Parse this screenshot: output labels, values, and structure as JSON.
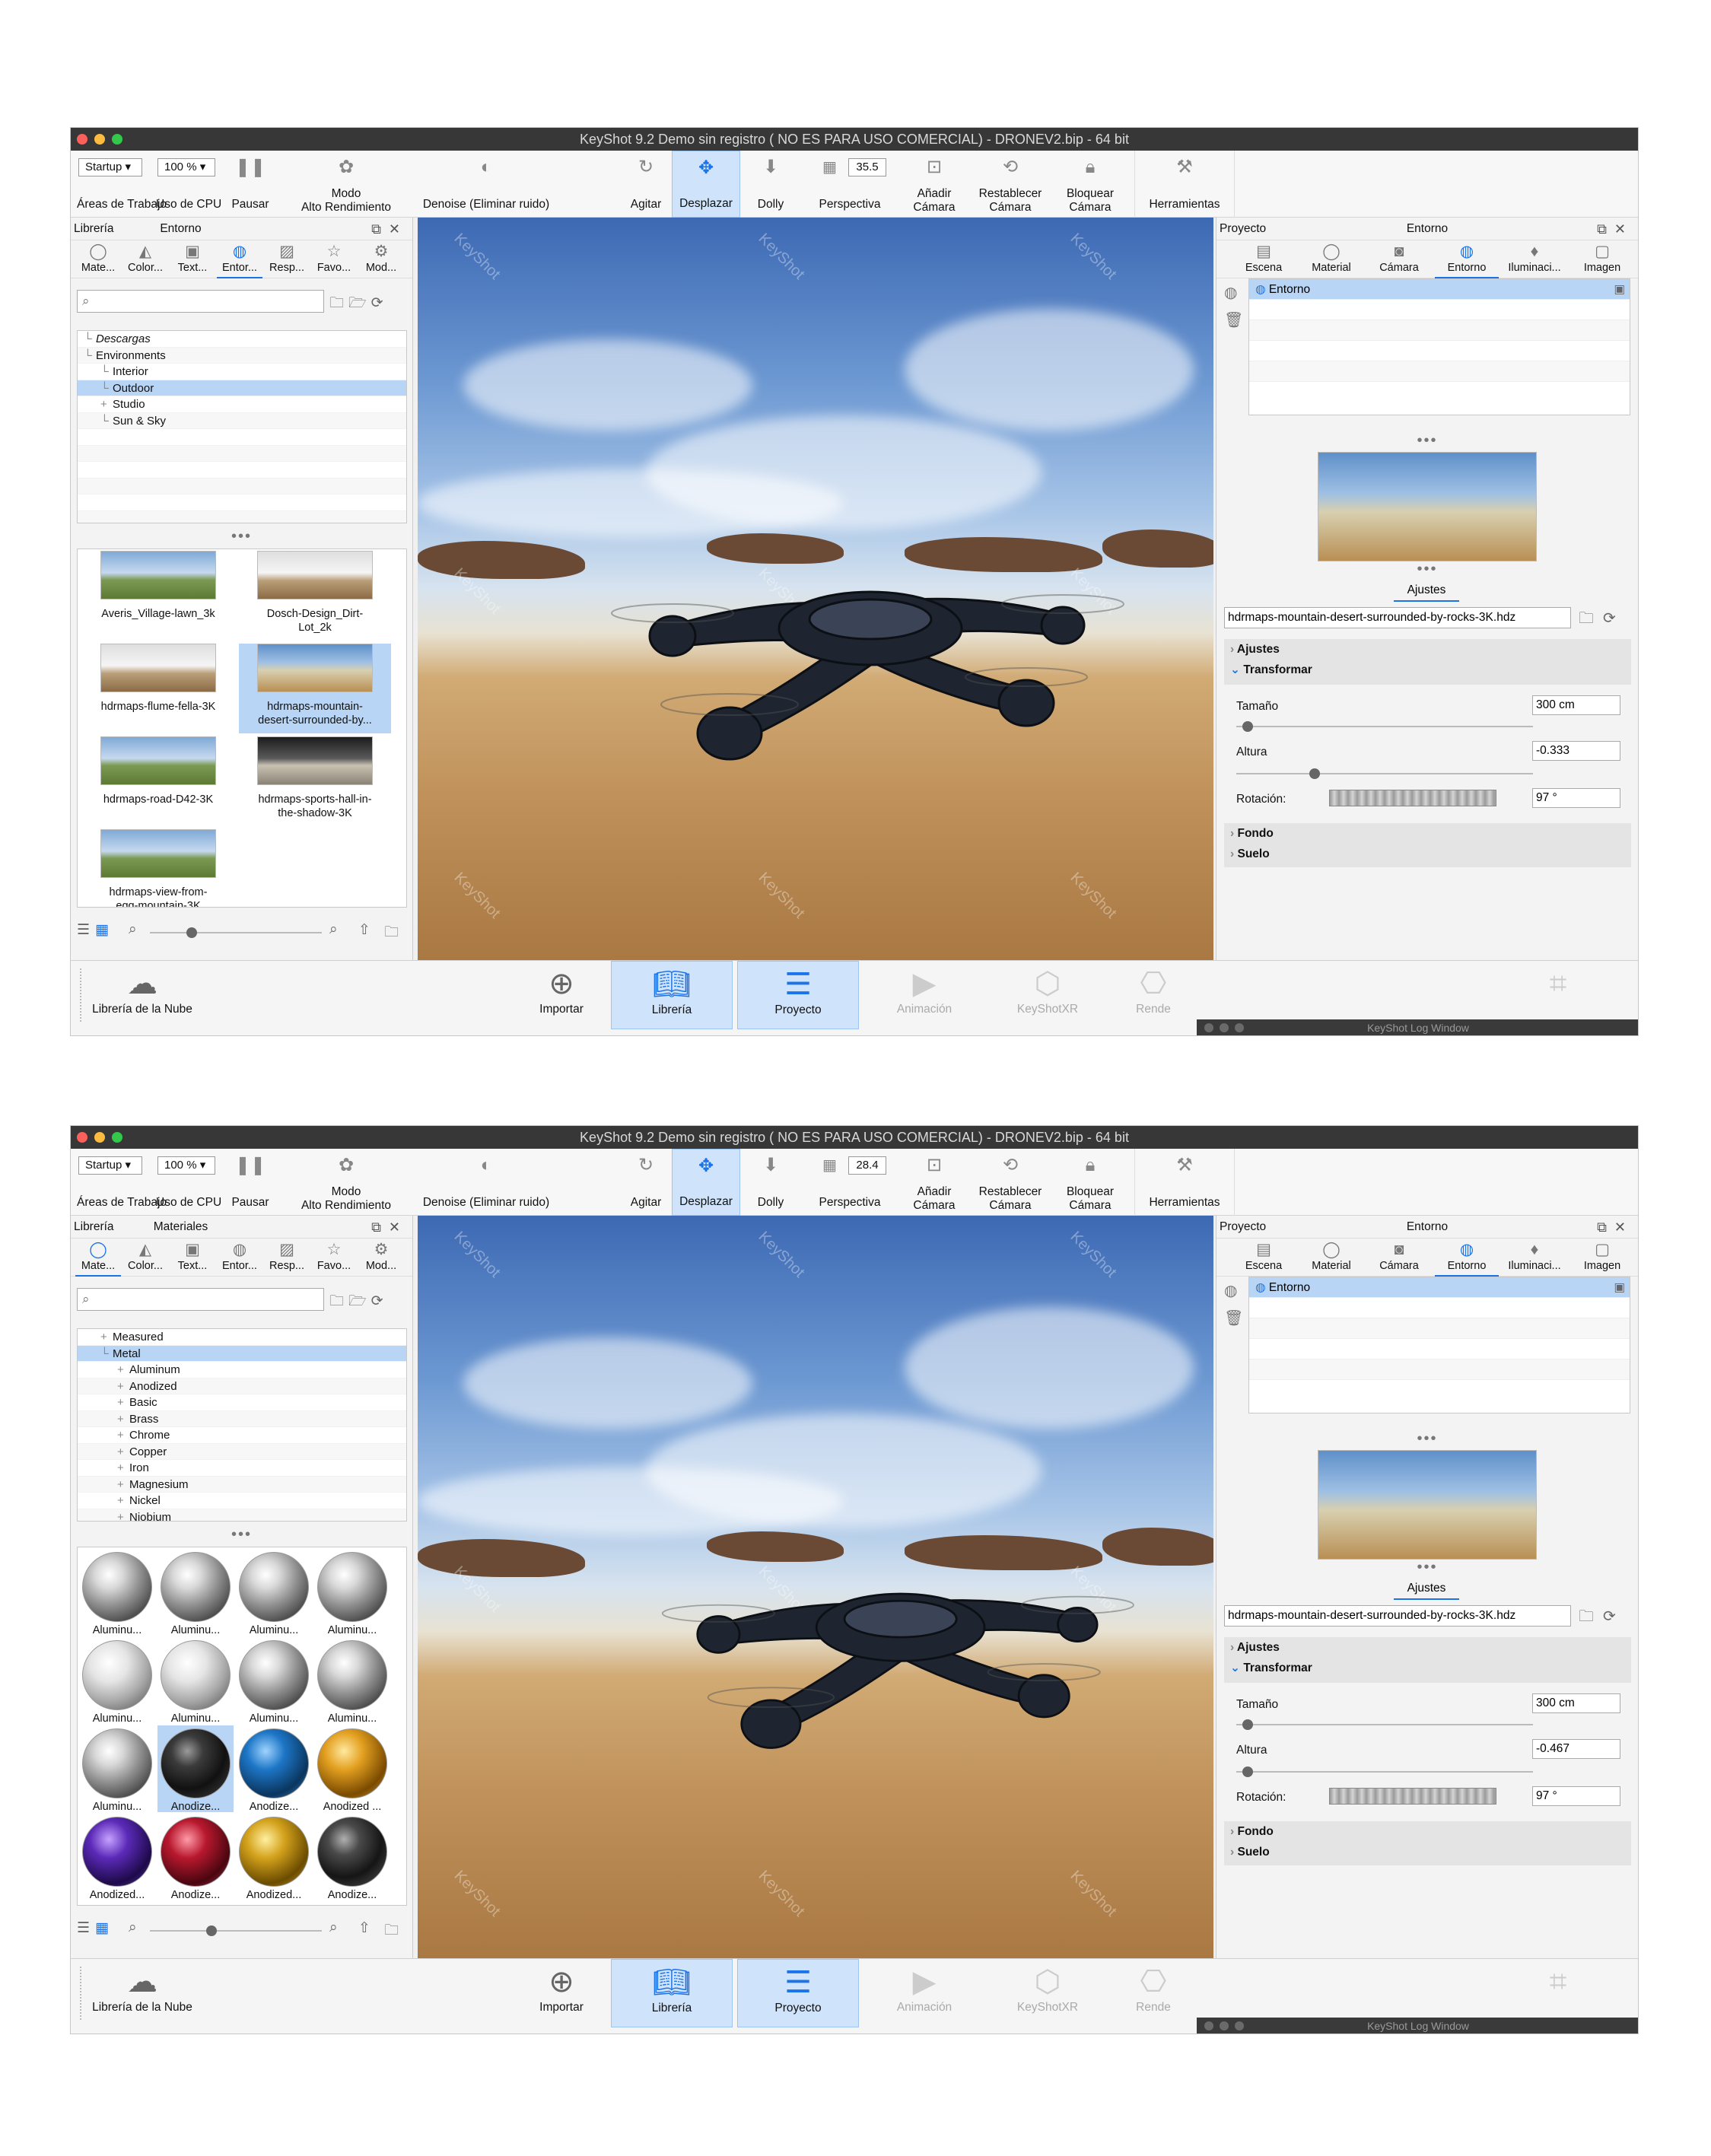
{
  "windows": [
    {
      "title": "KeyShot 9.2 Demo sin registro ( NO ES PARA USO COMERCIAL) - DRONEV2.bip  - 64 bit",
      "toolbar": {
        "workspace_value": "Startup",
        "workspace_label": "Áreas de Trabajo",
        "cpu_value": "100 %",
        "cpu_label": "Uso de CPU",
        "pause_label": "Pausar",
        "perf_label_1": "Modo",
        "perf_label_2": "Alto Rendimiento",
        "denoise_label": "Denoise (Eliminar ruido)",
        "tumble_label": "Agitar",
        "pan_label": "Desplazar",
        "dolly_label": "Dolly",
        "fov_value": "35.5",
        "perspective_label": "Perspectiva",
        "add_camera_1": "Añadir",
        "add_camera_2": "Cámara",
        "reset_camera_1": "Restablecer",
        "reset_camera_2": "Cámara",
        "lock_camera_1": "Bloquear",
        "lock_camera_2": "Cámara",
        "tools_label": "Herramientas"
      },
      "left": {
        "header_left": "Librería",
        "header_center": "Entorno",
        "tabs": [
          "Mate...",
          "Color...",
          "Text...",
          "Entor...",
          "Resp...",
          "Favo...",
          "Mod..."
        ],
        "tree": [
          {
            "label": "Descargas",
            "indent": 0,
            "italic": true
          },
          {
            "label": "Environments",
            "indent": 0
          },
          {
            "label": "Interior",
            "indent": 1
          },
          {
            "label": "Outdoor",
            "indent": 1,
            "selected": true
          },
          {
            "label": "Studio",
            "indent": 1,
            "expander": true
          },
          {
            "label": "Sun & Sky",
            "indent": 1
          }
        ],
        "thumbs": [
          {
            "label": "Averis_Village-lawn_3k",
            "label2": "",
            "style": "sky2"
          },
          {
            "label": "Dosch-Design_Dirt-",
            "label2": "Lot_2k",
            "style": "sky3"
          },
          {
            "label": "hdrmaps-flume-fella-3K",
            "label2": "",
            "style": "sky3"
          },
          {
            "label": "hdrmaps-mountain-",
            "label2": "desert-surrounded-by...",
            "style": "sky",
            "selected": true
          },
          {
            "label": "hdrmaps-road-D42-3K",
            "label2": "",
            "style": "sky2"
          },
          {
            "label": "hdrmaps-sports-hall-in-",
            "label2": "the-shadow-3K",
            "style": "sky4"
          },
          {
            "label": "hdrmaps-view-from-",
            "label2": "egg-mountain-3K",
            "style": "sky2"
          }
        ]
      },
      "right": {
        "header_left": "Proyecto",
        "header_center": "Entorno",
        "tabs": [
          "Escena",
          "Material",
          "Cámara",
          "Entorno",
          "Iluminaci...",
          "Imagen"
        ],
        "env_row": "Entorno",
        "subtab": "Ajustes",
        "hdr_path": "hdrmaps-mountain-desert-surrounded-by-rocks-3K.hdz",
        "sect_ajustes": "Ajustes",
        "sect_transformar": "Transformar",
        "size_label": "Tamaño",
        "size_value": "300 cm",
        "height_label": "Altura",
        "height_value": "-0.333",
        "rotation_label": "Rotación:",
        "rotation_value": "97 °",
        "sect_fondo": "Fondo",
        "sect_suelo": "Suelo"
      },
      "bottom": {
        "cloud": "Librería de la Nube",
        "import": "Importar",
        "library": "Librería",
        "project": "Proyecto",
        "animation": "Animación",
        "xr": "KeyShotXR",
        "render": "Rende",
        "log": "KeyShot Log Window"
      }
    },
    {
      "title": "KeyShot 9.2 Demo sin registro ( NO ES PARA USO COMERCIAL) - DRONEV2.bip  - 64 bit",
      "toolbar": {
        "workspace_value": "Startup",
        "workspace_label": "Áreas de Trabajo",
        "cpu_value": "100 %",
        "cpu_label": "Uso de CPU",
        "pause_label": "Pausar",
        "perf_label_1": "Modo",
        "perf_label_2": "Alto Rendimiento",
        "denoise_label": "Denoise (Eliminar ruido)",
        "tumble_label": "Agitar",
        "pan_label": "Desplazar",
        "dolly_label": "Dolly",
        "fov_value": "28.4",
        "perspective_label": "Perspectiva",
        "add_camera_1": "Añadir",
        "add_camera_2": "Cámara",
        "reset_camera_1": "Restablecer",
        "reset_camera_2": "Cámara",
        "lock_camera_1": "Bloquear",
        "lock_camera_2": "Cámara",
        "tools_label": "Herramientas"
      },
      "left": {
        "header_left": "Librería",
        "header_center": "Materiales",
        "tabs": [
          "Mate...",
          "Color...",
          "Text...",
          "Entor...",
          "Resp...",
          "Favo...",
          "Mod..."
        ],
        "tree": [
          {
            "label": "Measured",
            "indent": 1,
            "expander": true
          },
          {
            "label": "Metal",
            "indent": 1,
            "selected": true
          },
          {
            "label": "Aluminum",
            "indent": 2,
            "expander": true
          },
          {
            "label": "Anodized",
            "indent": 2,
            "expander": true
          },
          {
            "label": "Basic",
            "indent": 2,
            "expander": true
          },
          {
            "label": "Brass",
            "indent": 2,
            "expander": true
          },
          {
            "label": "Chrome",
            "indent": 2,
            "expander": true
          },
          {
            "label": "Copper",
            "indent": 2,
            "expander": true
          },
          {
            "label": "Iron",
            "indent": 2,
            "expander": true
          },
          {
            "label": "Magnesium",
            "indent": 2,
            "expander": true
          },
          {
            "label": "Nickel",
            "indent": 2,
            "expander": true
          },
          {
            "label": "Niobium",
            "indent": 2,
            "expander": true
          }
        ],
        "balls": [
          {
            "label": "Aluminu...",
            "style": "b-al"
          },
          {
            "label": "Aluminu...",
            "style": "b-al"
          },
          {
            "label": "Aluminu...",
            "style": "b-al"
          },
          {
            "label": "Aluminu...",
            "style": "b-al"
          },
          {
            "label": "Aluminu...",
            "style": "b-pat"
          },
          {
            "label": "Aluminu...",
            "style": "b-pat"
          },
          {
            "label": "Aluminu...",
            "style": "b-al"
          },
          {
            "label": "Aluminu...",
            "style": "b-al"
          },
          {
            "label": "Aluminu...",
            "style": "b-al"
          },
          {
            "label": "Anodize...",
            "style": "b-blk",
            "selected": true
          },
          {
            "label": "Anodize...",
            "style": "b-blu"
          },
          {
            "label": "Anodized ...",
            "style": "b-gld"
          },
          {
            "label": "Anodized...",
            "style": "b-pur"
          },
          {
            "label": "Anodize...",
            "style": "b-red"
          },
          {
            "label": "Anodized...",
            "style": "b-yel"
          },
          {
            "label": "Anodize...",
            "style": "b-blk2"
          }
        ]
      },
      "right": {
        "header_left": "Proyecto",
        "header_center": "Entorno",
        "tabs": [
          "Escena",
          "Material",
          "Cámara",
          "Entorno",
          "Iluminaci...",
          "Imagen"
        ],
        "env_row": "Entorno",
        "subtab": "Ajustes",
        "hdr_path": "hdrmaps-mountain-desert-surrounded-by-rocks-3K.hdz",
        "sect_ajustes": "Ajustes",
        "sect_transformar": "Transformar",
        "size_label": "Tamaño",
        "size_value": "300 cm",
        "height_label": "Altura",
        "height_value": "-0.467",
        "rotation_label": "Rotación:",
        "rotation_value": "97 °",
        "sect_fondo": "Fondo",
        "sect_suelo": "Suelo"
      },
      "bottom": {
        "cloud": "Librería de la Nube",
        "import": "Importar",
        "library": "Librería",
        "project": "Proyecto",
        "animation": "Animación",
        "xr": "KeyShotXR",
        "render": "Rende",
        "log": "KeyShot Log Window"
      }
    }
  ],
  "watermark": "KeyShot",
  "icons": {
    "pause": "pause-icon",
    "tumble": "rotate-icon",
    "pan": "move-icon",
    "dolly": "arrow-down-icon"
  }
}
